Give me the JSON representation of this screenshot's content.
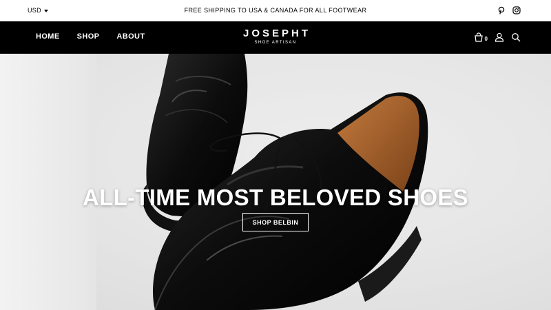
{
  "announcement_bar": {
    "currency": "USD",
    "message": "FREE SHIPPING TO USA & CANADA FOR ALL FOOTWEAR",
    "social_icons": [
      "pinterest-icon",
      "instagram-icon"
    ]
  },
  "header": {
    "nav": [
      "HOME",
      "SHOP",
      "ABOUT"
    ],
    "logo": {
      "name": "JOSEPHT",
      "tagline": "SHOE ARTISAN"
    },
    "cart_count": "0",
    "icons": [
      "cart-icon",
      "account-icon",
      "search-icon"
    ]
  },
  "hero": {
    "title": "ALL-TIME MOST BELOVED SHOES",
    "button_label": "SHOP BELBIN"
  },
  "colors": {
    "header_bg": "#000000",
    "topbar_bg": "#ffffff",
    "hero_text": "#ffffff"
  }
}
